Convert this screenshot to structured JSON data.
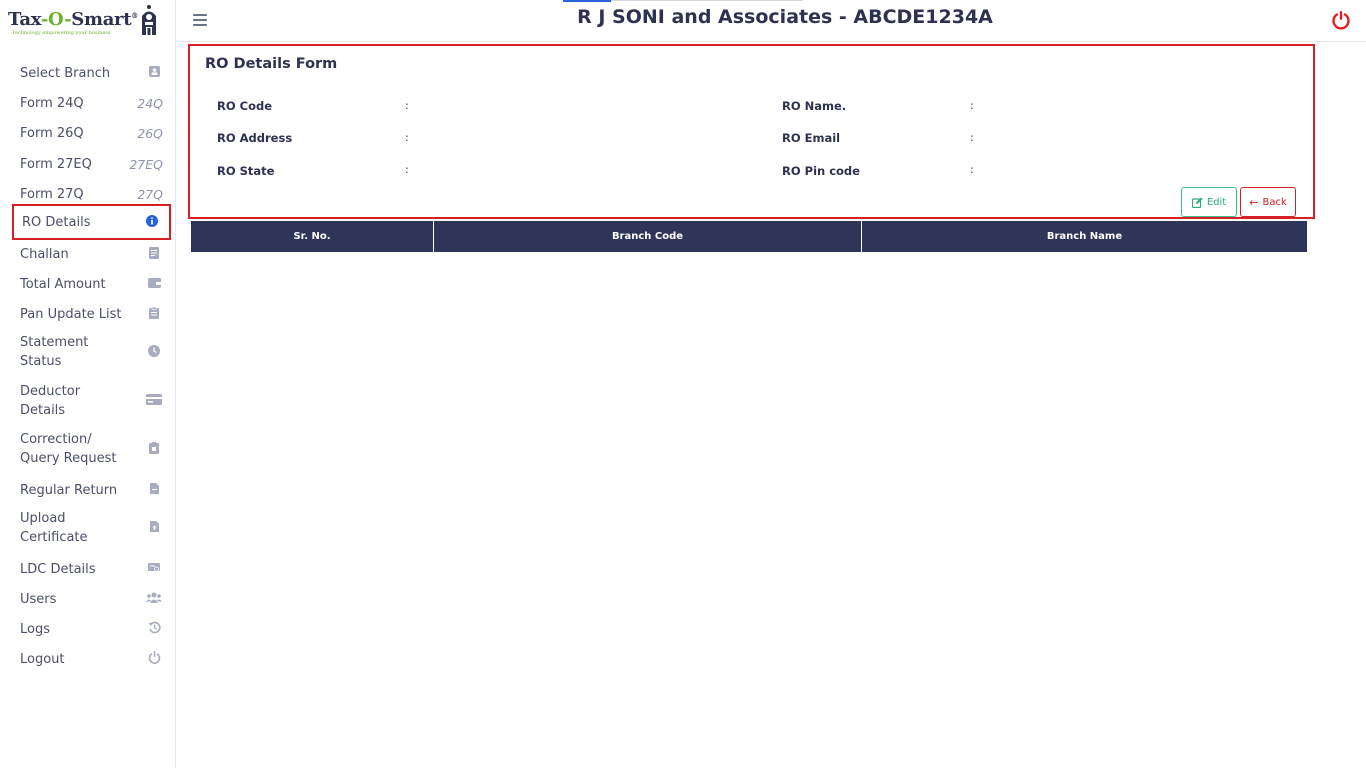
{
  "brand": {
    "logo_text_a": "Tax",
    "logo_text_b": "-O-",
    "logo_text_c": "Smart",
    "logo_reg": "®",
    "tagline": "Technology empowering your business"
  },
  "header": {
    "title": "R J SONI and Associates - ABCDE1234A"
  },
  "sidebar": {
    "items": [
      {
        "label": "Select Branch",
        "icon": "user-card-icon"
      },
      {
        "label": "Form 24Q",
        "icon_text": "24Q"
      },
      {
        "label": "Form 26Q",
        "icon_text": "26Q"
      },
      {
        "label": "Form 27EQ",
        "icon_text": "27EQ"
      },
      {
        "label": "Form 27Q",
        "icon_text": "27Q"
      },
      {
        "label": "RO Details",
        "icon": "info-icon",
        "active": true
      },
      {
        "label": "Challan",
        "icon": "receipt-icon"
      },
      {
        "label": "Total Amount",
        "icon": "wallet-icon"
      },
      {
        "label": "Pan Update List",
        "icon": "clipboard-icon"
      },
      {
        "label": "Statement Status",
        "label_line1": "Statement",
        "label_line2": "Status",
        "icon": "clock-icon"
      },
      {
        "label": "Deductor Details",
        "label_line1": "Deductor",
        "label_line2": "Details",
        "icon": "card-icon"
      },
      {
        "label": "Correction/ Query Request",
        "label_line1": "Correction/",
        "label_line2": "Query Request",
        "icon": "clipboard-edit-icon"
      },
      {
        "label": "Regular Return",
        "icon": "file-icon"
      },
      {
        "label": "Upload Certificate",
        "label_line1": "Upload",
        "label_line2": "Certificate",
        "icon": "file-upload-icon"
      },
      {
        "label": "LDC Details",
        "icon": "certificate-icon"
      },
      {
        "label": "Users",
        "icon": "users-icon"
      },
      {
        "label": "Logs",
        "icon": "history-icon"
      },
      {
        "label": "Logout",
        "icon": "power-icon"
      }
    ]
  },
  "form": {
    "title": "RO Details Form",
    "fields": [
      {
        "label": "RO Code",
        "colon": ":",
        "value": ""
      },
      {
        "label": "RO Name.",
        "colon": ":",
        "value": ""
      },
      {
        "label": "RO Address",
        "colon": ":",
        "value": ""
      },
      {
        "label": "RO Email",
        "colon": ":",
        "value": ""
      },
      {
        "label": "RO State",
        "colon": ":",
        "value": ""
      },
      {
        "label": "RO Pin code",
        "colon": ":",
        "value": ""
      }
    ],
    "edit_label": "Edit",
    "back_label": "Back"
  },
  "table": {
    "columns": [
      "Sr. No.",
      "Branch Code",
      "Branch Name"
    ],
    "rows": []
  },
  "colors": {
    "primary_navy": "#2f3558",
    "highlight_red": "#d61f26",
    "edit_green": "#2cae74",
    "brand_green": "#6bb32e",
    "active_blue": "#2a63d8"
  }
}
